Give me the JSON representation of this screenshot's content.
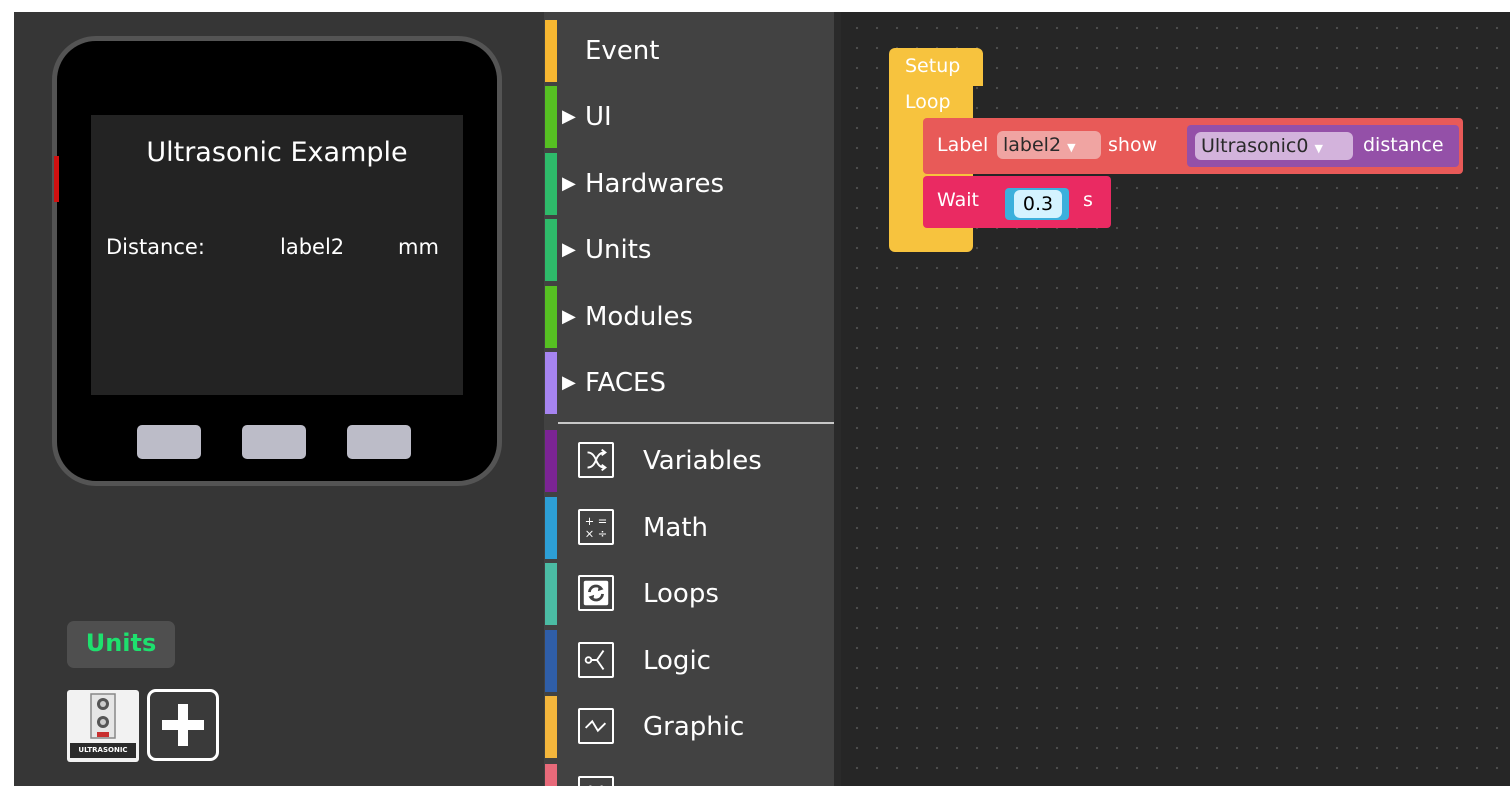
{
  "device": {
    "screen_title": "Ultrasonic Example",
    "distance_label": "Distance:",
    "value_label": "label2",
    "unit_label": "mm"
  },
  "units_panel": {
    "title": "Units",
    "unit_thumb_text": "ULTRASONIC"
  },
  "toolbox": {
    "categories": [
      {
        "label": "Event",
        "color": "#f7b731",
        "expandable": false
      },
      {
        "label": "UI",
        "color": "#56c022",
        "expandable": true
      },
      {
        "label": "Hardwares",
        "color": "#2ebb6a",
        "expandable": true
      },
      {
        "label": "Units",
        "color": "#2ebb6a",
        "expandable": true
      },
      {
        "label": "Modules",
        "color": "#56c022",
        "expandable": true
      },
      {
        "label": "FACES",
        "color": "#a684f0",
        "expandable": true
      }
    ],
    "builtins": [
      {
        "label": "Variables",
        "color": "#7b2494",
        "icon": "variables-icon"
      },
      {
        "label": "Math",
        "color": "#2d9fd6",
        "icon": "math-icon"
      },
      {
        "label": "Loops",
        "color": "#4bbca4",
        "icon": "loops-icon"
      },
      {
        "label": "Logic",
        "color": "#2f5ea8",
        "icon": "logic-icon"
      },
      {
        "label": "Graphic",
        "color": "#f4b63c",
        "icon": "graphic-icon"
      },
      {
        "label": "",
        "color": "#e86a7a",
        "icon": "emoji-icon"
      }
    ]
  },
  "workspace": {
    "setup_label": "Setup",
    "loop_label": "Loop",
    "label_block": {
      "keyword": "Label",
      "label_dropdown": "label2",
      "show_text": "show",
      "sensor_dropdown": "Ultrasonic0",
      "distance_text": "distance"
    },
    "wait_block": {
      "keyword": "Wait",
      "value": "0.3",
      "unit": "s"
    }
  }
}
